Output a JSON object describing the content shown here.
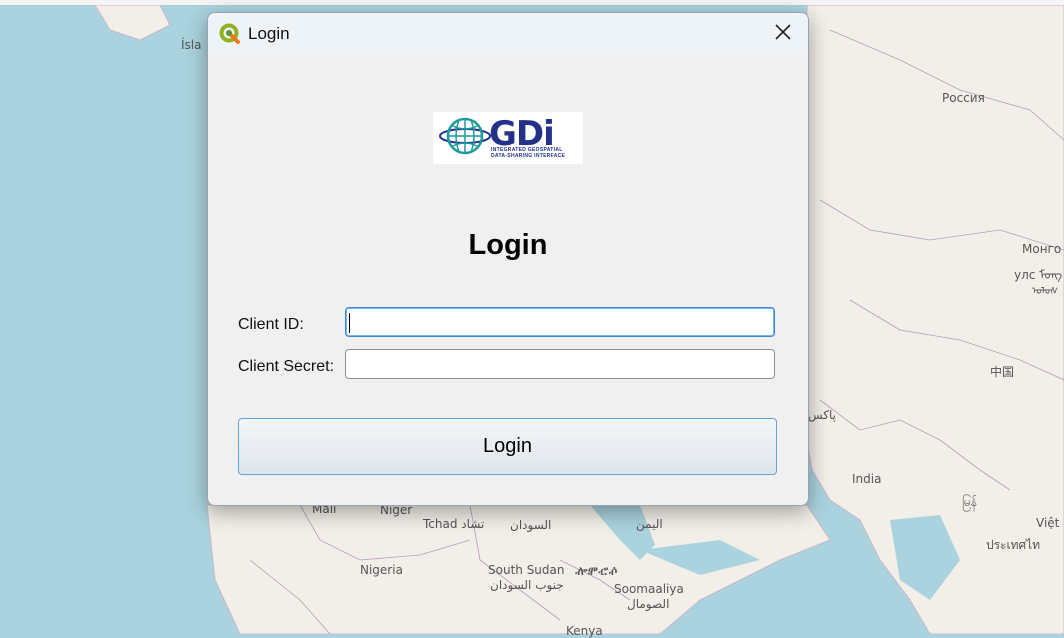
{
  "map": {
    "labels": {
      "island": "Ísla",
      "russia": "Россия",
      "mongolia_1": "Монго",
      "mongolia_2": "улс ᠮᠣᠩ",
      "mongolia_3": "ᠣᠯᠣᠰ",
      "china": "中国",
      "pakistan": "پاکس",
      "india": "India",
      "myanmar": "မြန်",
      "vietnam": "Việt",
      "thailand": "ประเทศไท",
      "mali": "Mali",
      "niger": "Niger",
      "tchad": "Tchad تشاد",
      "sudan": "السودان",
      "yemen": "اليمن",
      "nigeria": "Nigeria",
      "south_sudan": "South Sudan",
      "south_sudan_ethiopic": "ⶀⶁⶂⶃ",
      "south_sudan_ar": "جنوب السودان",
      "somalia": "Soomaaliya",
      "somalia_ar": "الصومال",
      "kenya": "Kenya"
    }
  },
  "dialog": {
    "title": "Login",
    "app_icon": "qgis-icon",
    "close_icon": "close-icon",
    "logo": {
      "text": "GDi",
      "subtitle": "INTEGRATED GEOSPATIAL\nDATA-SHARING INTERFACE",
      "icon": "globe-icon"
    },
    "heading": "Login",
    "client_id_label": "Client ID:",
    "client_id_value": "",
    "client_secret_label": "Client Secret:",
    "client_secret_value": "",
    "login_button": "Login"
  }
}
